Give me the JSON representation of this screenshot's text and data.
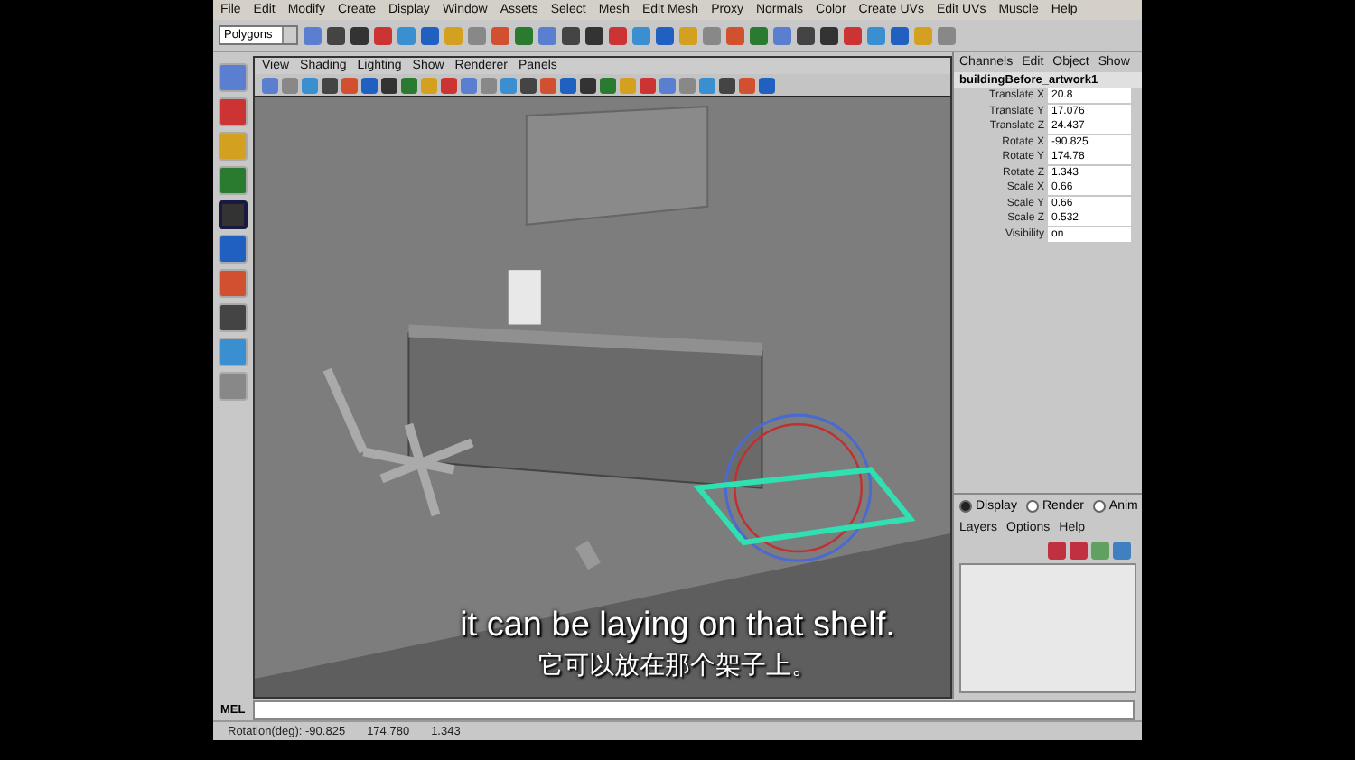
{
  "menu_bar": [
    "File",
    "Edit",
    "Modify",
    "Create",
    "Display",
    "Window",
    "Assets",
    "Select",
    "Mesh",
    "Edit Mesh",
    "Proxy",
    "Normals",
    "Color",
    "Create UVs",
    "Edit UVs",
    "Muscle",
    "Help"
  ],
  "shelf": {
    "mode": "Polygons"
  },
  "toolbox": [
    {
      "selected": false
    },
    {
      "selected": false
    },
    {
      "selected": false
    },
    {
      "selected": false
    },
    {
      "selected": true
    },
    {
      "selected": false
    },
    {
      "selected": false
    },
    {
      "selected": false
    },
    {
      "selected": false
    },
    {
      "selected": false
    }
  ],
  "panel_menu": [
    "View",
    "Shading",
    "Lighting",
    "Show",
    "Renderer",
    "Panels"
  ],
  "channel_box": {
    "menu": [
      "Channels",
      "Edit",
      "Object",
      "Show"
    ],
    "object": "buildingBefore_artwork1",
    "attributes": [
      {
        "name": "Translate X",
        "value": "20.8"
      },
      {
        "name": "Translate Y",
        "value": "17.076"
      },
      {
        "name": "Translate Z",
        "value": "24.437"
      },
      {
        "name": "Rotate X",
        "value": "-90.825"
      },
      {
        "name": "Rotate Y",
        "value": "174.78"
      },
      {
        "name": "Rotate Z",
        "value": "1.343"
      },
      {
        "name": "Scale X",
        "value": "0.66"
      },
      {
        "name": "Scale Y",
        "value": "0.66"
      },
      {
        "name": "Scale Z",
        "value": "0.532"
      },
      {
        "name": "Visibility",
        "value": "on"
      }
    ]
  },
  "layer_editor": {
    "modes": [
      {
        "label": "Display",
        "selected": true
      },
      {
        "label": "Render",
        "selected": false
      },
      {
        "label": "Anim",
        "selected": false
      }
    ],
    "menu": [
      "Layers",
      "Options",
      "Help"
    ]
  },
  "command_line": {
    "label": "MEL"
  },
  "help_line": {
    "label": "Rotation(deg):",
    "values": [
      "-90.825",
      "174.780",
      "1.343"
    ]
  },
  "subtitles": [
    "it can be laying on that shelf.",
    "它可以放在那个架子上。"
  ]
}
